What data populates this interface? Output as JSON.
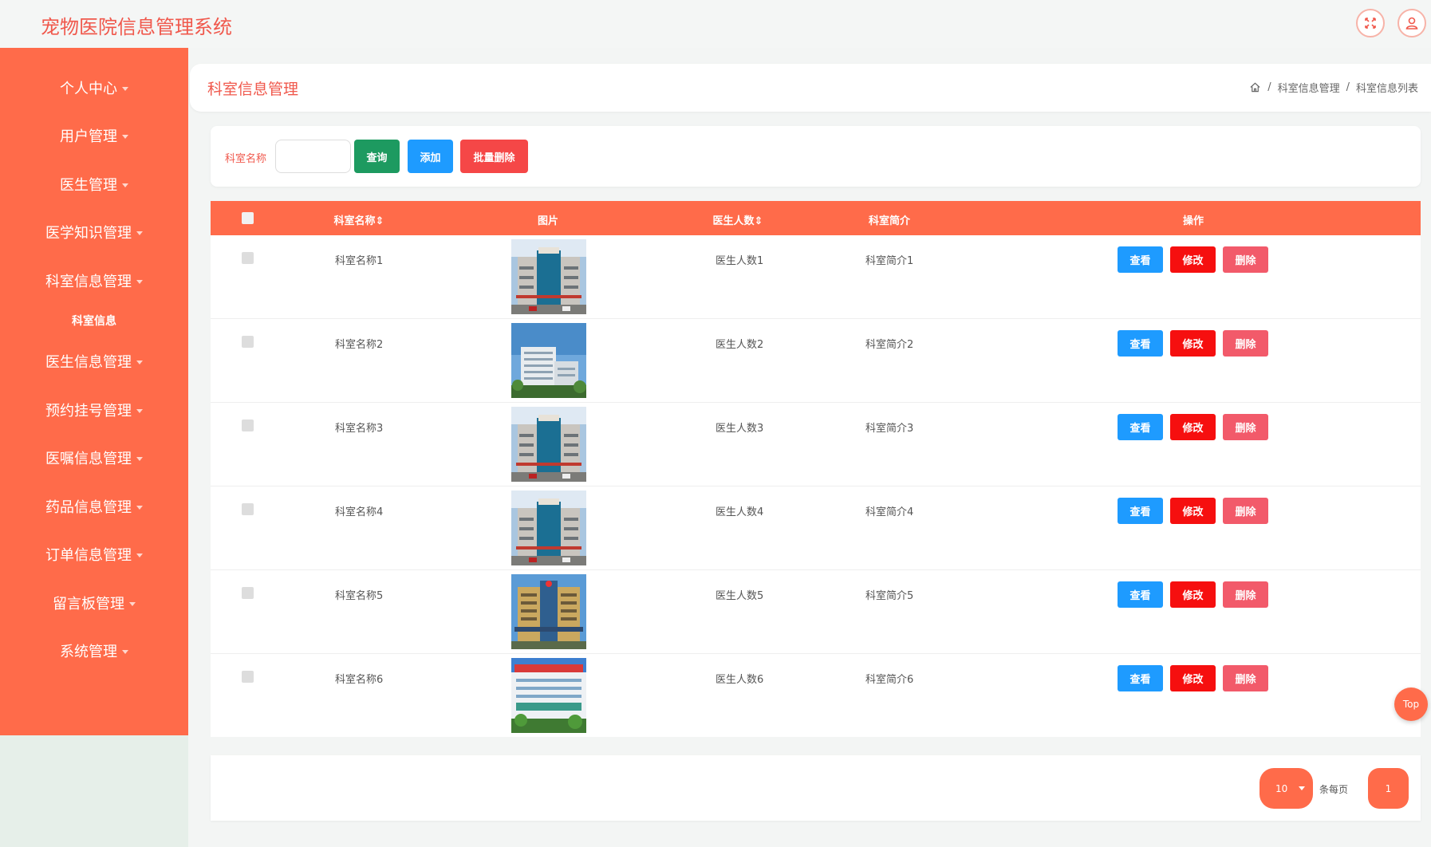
{
  "app": {
    "title": "宠物医院信息管理系统"
  },
  "header": {
    "fullscreen_icon": "fullscreen-icon",
    "user_icon": "user-icon"
  },
  "sidebar": {
    "items": [
      {
        "label": "个人中心"
      },
      {
        "label": "用户管理"
      },
      {
        "label": "医生管理"
      },
      {
        "label": "医学知识管理"
      },
      {
        "label": "科室信息管理"
      },
      {
        "label": "医生信息管理"
      },
      {
        "label": "预约挂号管理"
      },
      {
        "label": "医嘱信息管理"
      },
      {
        "label": "药品信息管理"
      },
      {
        "label": "订单信息管理"
      },
      {
        "label": "留言板管理"
      },
      {
        "label": "系统管理"
      }
    ],
    "active_sub": "科室信息"
  },
  "page": {
    "title": "科室信息管理",
    "breadcrumb": [
      "科室信息管理",
      "科室信息列表"
    ],
    "breadcrumb_sep": "/"
  },
  "search": {
    "label": "科室名称",
    "value": "",
    "placeholder": "",
    "query_label": "查询",
    "add_label": "添加",
    "batch_delete_label": "批量删除"
  },
  "table": {
    "headers": {
      "name": "科室名称",
      "image": "图片",
      "doctor_count": "医生人数",
      "intro": "科室简介",
      "actions": "操作"
    },
    "sort_mark": "⇕",
    "rows": [
      {
        "name": "科室名称1",
        "doctor_count": "医生人数1",
        "intro": "科室简介1",
        "image": "hospital-a"
      },
      {
        "name": "科室名称2",
        "doctor_count": "医生人数2",
        "intro": "科室简介2",
        "image": "hospital-b"
      },
      {
        "name": "科室名称3",
        "doctor_count": "医生人数3",
        "intro": "科室简介3",
        "image": "hospital-a"
      },
      {
        "name": "科室名称4",
        "doctor_count": "医生人数4",
        "intro": "科室简介4",
        "image": "hospital-a"
      },
      {
        "name": "科室名称5",
        "doctor_count": "医生人数5",
        "intro": "科室简介5",
        "image": "hospital-c"
      },
      {
        "name": "科室名称6",
        "doctor_count": "医生人数6",
        "intro": "科室简介6",
        "image": "hospital-d"
      }
    ],
    "view_label": "查看",
    "edit_label": "修改",
    "delete_label": "删除"
  },
  "pagination": {
    "page_size": "10",
    "per_page_label": "条每页",
    "current_page": "1"
  },
  "back_to_top": "Top",
  "colors": {
    "primary": "#ff6b4a",
    "title_text": "#f0584c",
    "query_button": "#1d9a60",
    "add_button": "#1e9bff",
    "batch_delete_button": "#f54747",
    "edit_button": "#f60f0f",
    "delete_button": "#f25a6a"
  }
}
